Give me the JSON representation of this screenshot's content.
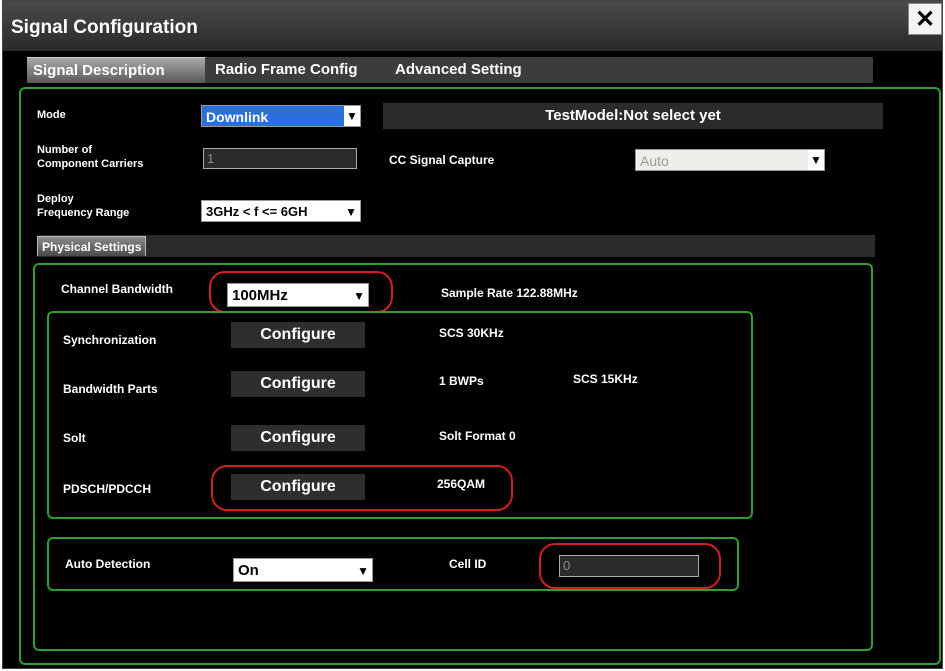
{
  "window": {
    "title": "Signal Configuration",
    "close_glyph": "✕"
  },
  "tabs": [
    {
      "label": "Signal Description",
      "active": true
    },
    {
      "label": "Radio Frame Config",
      "active": false
    },
    {
      "label": "Advanced Setting",
      "active": false
    }
  ],
  "signal": {
    "mode_label": "Mode",
    "mode_value": "Downlink",
    "test_model": "TestModel:Not select yet",
    "num_cc_label_1": "Number of",
    "num_cc_label_2": "Component Carriers",
    "num_cc_value": "1",
    "cc_capture_label": "CC Signal Capture",
    "cc_capture_value": "Auto",
    "deploy_label_1": "Deploy",
    "deploy_label_2": "Frequency Range",
    "deploy_value": "3GHz < f <= 6GH"
  },
  "physical": {
    "section_label": "Physical Settings",
    "channel_bw_label": "Channel Bandwidth",
    "channel_bw_value": "100MHz",
    "sample_rate": "Sample Rate 122.88MHz",
    "rows": [
      {
        "label": "Synchronization",
        "button": "Configure",
        "info": "SCS 30KHz",
        "info2": ""
      },
      {
        "label": "Bandwidth Parts",
        "button": "Configure",
        "info": "1 BWPs",
        "info2": "SCS 15KHz"
      },
      {
        "label": "Solt",
        "button": "Configure",
        "info": "Solt Format 0",
        "info2": ""
      },
      {
        "label": "PDSCH/PDCCH",
        "button": "Configure",
        "info": "256QAM",
        "info2": ""
      }
    ],
    "auto_detection_label": "Auto Detection",
    "auto_detection_value": "On",
    "cell_id_label": "Cell ID",
    "cell_id_value": "0"
  },
  "colors": {
    "panel_border": "#2e9e2e",
    "highlight": "#d21f1f",
    "selected_blue": "#2a6fdb"
  },
  "dropdown_glyph": "▼"
}
